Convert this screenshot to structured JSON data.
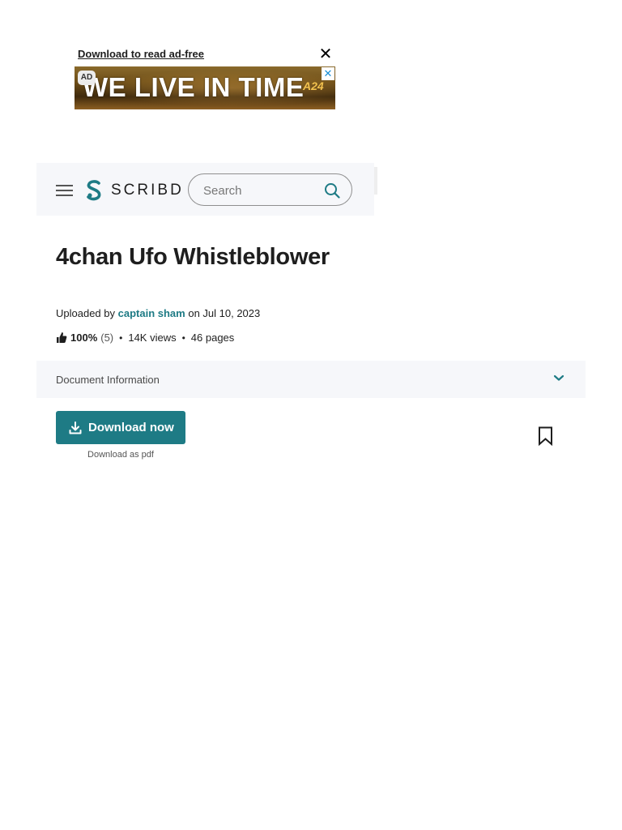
{
  "ad": {
    "download_link": "Download to read ad-free",
    "close_symbol": "✕",
    "badge": "AD",
    "headline": "WE LIVE IN TIME",
    "brand": "A24",
    "dismiss_symbol": "✕"
  },
  "header": {
    "logo_text": "SCRIBD",
    "search_placeholder": "Search",
    "icons": [
      "menu-icon",
      "scribd-logo-icon",
      "search-icon"
    ]
  },
  "document": {
    "title": "4chan Ufo Whistleblower",
    "uploaded_prefix": "Uploaded by",
    "author": "captain sham",
    "uploaded_suffix": "on Jul 10, 2023",
    "rating_percent": "100%",
    "rating_count": "(5)",
    "views": "14K views",
    "pages": "46 pages",
    "separator": "•"
  },
  "info_bar": {
    "label": "Document Information"
  },
  "actions": {
    "download_label": "Download now",
    "download_sub": "Download as pdf"
  },
  "colors": {
    "accent": "#1e7b85",
    "bar_bg": "#f6f7fa"
  }
}
